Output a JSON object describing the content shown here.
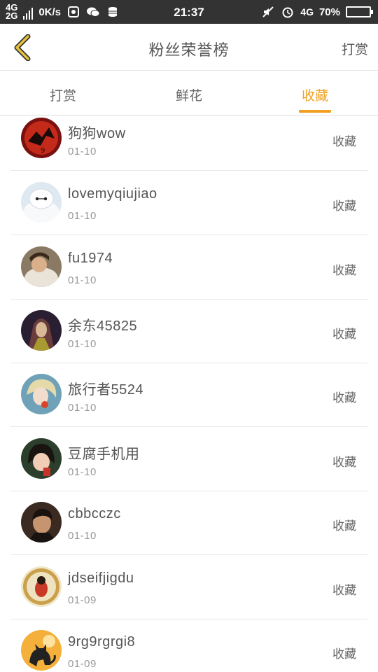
{
  "status_bar": {
    "net_top": "4G",
    "net_bottom": "2G",
    "speed": "0K/s",
    "time": "21:37",
    "network_right": "4G",
    "battery_percent": "70%",
    "battery_level": 0.7,
    "icons": [
      "signal-icon",
      "app-notification-icon",
      "wechat-icon",
      "storage-icon",
      "mute-icon",
      "alarm-icon",
      "battery-icon"
    ]
  },
  "header": {
    "title": "粉丝荣誉榜",
    "action_label": "打赏",
    "back_icon": "chevron-left-icon"
  },
  "tabs": [
    {
      "label": "打赏",
      "active": false
    },
    {
      "label": "鲜花",
      "active": false
    },
    {
      "label": "收藏",
      "active": true
    }
  ],
  "accent_color": "#f0a020",
  "list": [
    {
      "name": "狗狗wow",
      "date": "01-10",
      "action": "收藏"
    },
    {
      "name": "lovemyqiujiao",
      "date": "01-10",
      "action": "收藏"
    },
    {
      "name": "fu1974",
      "date": "01-10",
      "action": "收藏"
    },
    {
      "name": "余东45825",
      "date": "01-10",
      "action": "收藏"
    },
    {
      "name": "旅行者5524",
      "date": "01-10",
      "action": "收藏"
    },
    {
      "name": "豆腐手机用",
      "date": "01-10",
      "action": "收藏"
    },
    {
      "name": "cbbcczc",
      "date": "01-10",
      "action": "收藏"
    },
    {
      "name": "jdseifjigdu",
      "date": "01-09",
      "action": "收藏"
    },
    {
      "name": "9rg9rgrgi8",
      "date": "01-09",
      "action": "收藏"
    }
  ]
}
